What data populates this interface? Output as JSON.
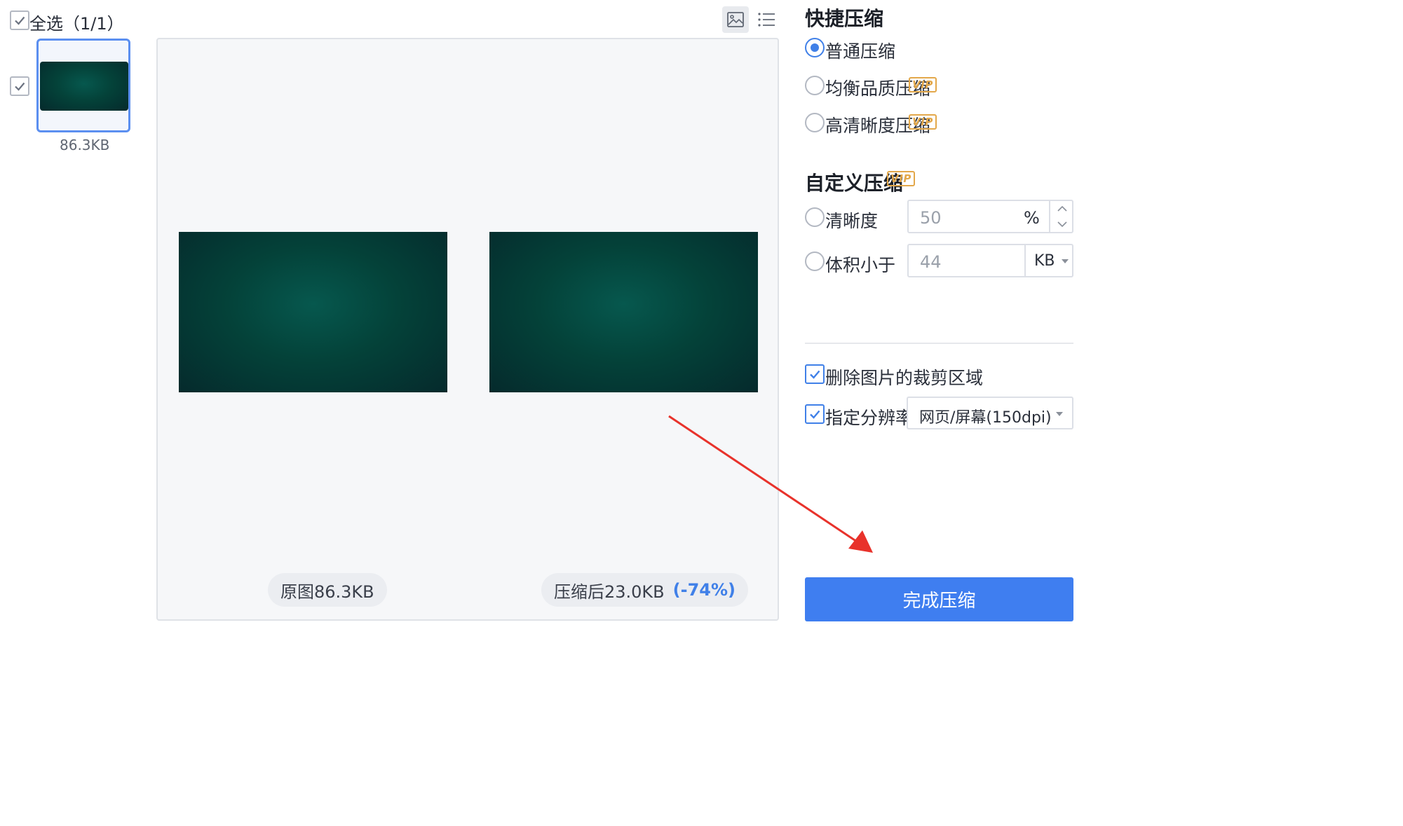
{
  "toolbar": {
    "select_all_label": "全选（1/1）",
    "view_image_icon": "image-view-icon",
    "view_list_icon": "list-view-icon"
  },
  "thumbnails": [
    {
      "size": "86.3KB",
      "checked": true
    }
  ],
  "preview": {
    "original_label": "原图86.3KB",
    "compressed_label": "压缩后23.0KB",
    "compressed_ratio": "(-74%)"
  },
  "quick": {
    "title": "快捷压缩",
    "options": [
      {
        "label": "普通压缩",
        "selected": true,
        "vip": false
      },
      {
        "label": "均衡品质压缩",
        "selected": false,
        "vip": true
      },
      {
        "label": "高清晰度压缩",
        "selected": false,
        "vip": true
      }
    ],
    "vip_badge": "VIP"
  },
  "custom": {
    "title": "自定义压缩",
    "clarity_label": "清晰度",
    "clarity_value": "50",
    "clarity_unit": "%",
    "size_label": "体积小于",
    "size_value": "44",
    "size_unit": "KB"
  },
  "options": {
    "remove_crop_label": "删除图片的裁剪区域",
    "remove_crop_checked": true,
    "resolution_label": "指定分辨率",
    "resolution_checked": true,
    "resolution_value": "网页/屏幕(150dpi)"
  },
  "action": {
    "finish_label": "完成压缩"
  },
  "colors": {
    "accent": "#4080e8",
    "vip": "#e3a84b",
    "arrow": "#e8322b"
  }
}
